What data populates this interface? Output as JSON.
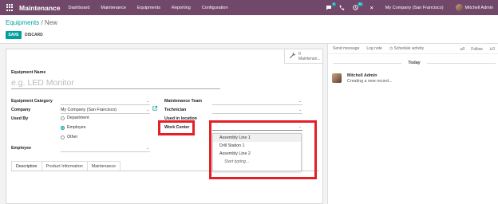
{
  "navbar": {
    "brand": "Maintenance",
    "menu": [
      "Dashboard",
      "Maintenance",
      "Equipments",
      "Reporting",
      "Configuration"
    ],
    "chat_badge": "5",
    "activity_badge": "30",
    "company": "My Company (San Francisco)",
    "user": "Mitchell Admin"
  },
  "control": {
    "breadcrumb_parent": "Equipments",
    "breadcrumb_sep": " / ",
    "breadcrumb_current": "New",
    "save_label": "SAVE",
    "discard_label": "DISCARD"
  },
  "form": {
    "stat_count": "0",
    "stat_label": "Maintenan...",
    "name_label": "Equipment Name",
    "name_placeholder": "e.g. LED Monitor",
    "category_label": "Equipment Category",
    "company_label": "Company",
    "company_value": "My Company (San Francisco)",
    "used_by_label": "Used By",
    "used_by_options": [
      "Department",
      "Employee",
      "Other"
    ],
    "used_by_selected": "Employee",
    "employee_label": "Employee",
    "team_label": "Maintenance Team",
    "technician_label": "Technician",
    "location_label": "Used in location",
    "workcenter_label": "Work Center",
    "tabs": [
      "Description",
      "Product Information",
      "Maintenance"
    ],
    "active_tab": "Description"
  },
  "dropdown": {
    "items": [
      "Assembly Line 1",
      "Drill Station 1",
      "Assembly Line 2"
    ],
    "hint": "Start typing..."
  },
  "chatter": {
    "send_message": "Send message",
    "log_note": "Log note",
    "schedule_activity": "Schedule activity",
    "attachments_count": "0",
    "follow_label": "Follow",
    "followers_count": "0",
    "today_label": "Today",
    "message_author": "Mitchell Admin",
    "message_body": "Creating a new record..."
  },
  "colors": {
    "navbar": "#71476a",
    "accent": "#00a09d",
    "highlight": "#e32027"
  }
}
